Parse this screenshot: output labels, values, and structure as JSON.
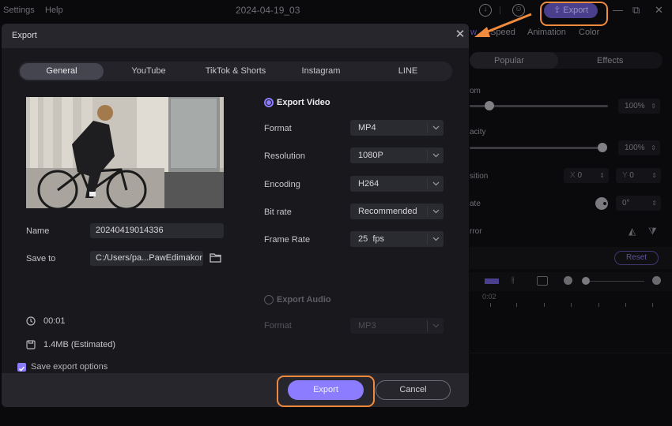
{
  "app": {
    "menu": [
      "Settings",
      "Help"
    ],
    "project_title": "2024-04-19_03",
    "top_export_label": "Export",
    "window_controls": [
      "minimize-icon",
      "restore-icon",
      "close-icon"
    ],
    "right_panel": {
      "tabs": [
        "w",
        "Speed",
        "Animation",
        "Color"
      ],
      "segments": [
        "Popular",
        "Effects"
      ],
      "properties": {
        "zoom_label": "om",
        "zoom_value": "100%",
        "opacity_label": "acity",
        "opacity_value": "100%",
        "position_label": "sition",
        "position_x": "0",
        "position_y": "0",
        "x_prefix": "X",
        "y_prefix": "Y",
        "rotate_label": "ate",
        "rotate_value": "0°",
        "mirror_label": "rror"
      },
      "reset_label": "Reset",
      "timeline_time": "0:02"
    }
  },
  "dialog": {
    "title": "Export",
    "tabs": [
      {
        "label": "General",
        "active": true
      },
      {
        "label": "YouTube",
        "active": false
      },
      {
        "label": "TikTok & Shorts",
        "active": false
      },
      {
        "label": "Instagram",
        "active": false
      },
      {
        "label": "LINE",
        "active": false
      }
    ],
    "name_label": "Name",
    "name_value": "20240419014336",
    "save_to_label": "Save to",
    "save_to_value": "C:/Users/pa...PawEdimakor",
    "duration": "00:01",
    "size": "1.4MB (Estimated)",
    "export_video": {
      "label": "Export Video",
      "selected": true,
      "options": [
        {
          "label": "Format",
          "value": "MP4"
        },
        {
          "label": "Resolution",
          "value": "1080P"
        },
        {
          "label": "Encoding",
          "value": "H264"
        },
        {
          "label": "Bit rate",
          "value": "Recommended"
        },
        {
          "label": "Frame Rate",
          "value": "25  fps"
        }
      ]
    },
    "export_audio": {
      "label": "Export Audio",
      "selected": false,
      "format_label": "Format",
      "format_value": "MP3"
    },
    "save_options_label": "Save export options",
    "save_options_checked": true,
    "export_button": "Export",
    "cancel_button": "Cancel"
  },
  "colors": {
    "accent": "#8c7cff",
    "annotation": "#f08a3c"
  }
}
